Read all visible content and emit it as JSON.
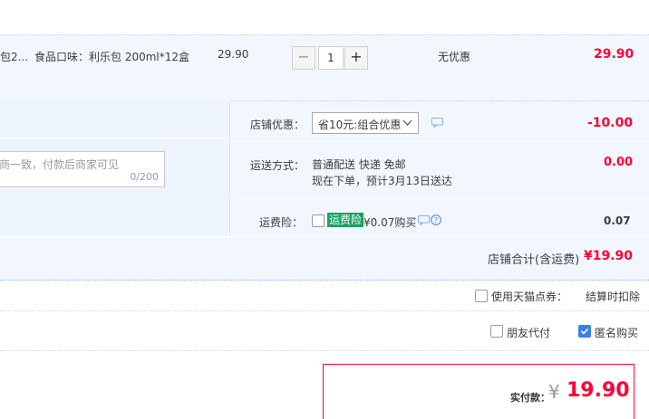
{
  "item": {
    "title_fragment": "包2...",
    "spec": "食品口味：利乐包 200ml*12盒",
    "unit_price": "29.90",
    "qty_minus": "−",
    "qty_value": "1",
    "qty_plus": "+",
    "discount_text": "无优惠",
    "subtotal": "29.90"
  },
  "shop_discount": {
    "label": "店铺优惠：",
    "selected": "省10元:组合优惠",
    "amount": "-10.00"
  },
  "shipping": {
    "label": "运送方式：",
    "line1": "普通配送 快递 免邮",
    "line2": "现在下单，预计3月13日送达",
    "amount": "0.00"
  },
  "insurance": {
    "label": "运费险：",
    "tag": "运费险",
    "price_text": "¥0.07购买",
    "amount": "0.07"
  },
  "message": {
    "placeholder_fragment": "商一致，付款后商家可见",
    "counter": "0/200"
  },
  "shop_total": {
    "label": "店铺合计(含运费)",
    "amount": "¥19.90"
  },
  "points": {
    "label": "使用天猫点券：",
    "note": "结算时扣除"
  },
  "options": {
    "friend_pay": "朋友代付",
    "anonymous": "匿名购买",
    "anonymous_checked": true,
    "friend_pay_checked": false
  },
  "payment": {
    "label": "实付款：",
    "currency": "¥",
    "amount": "19.90"
  },
  "colors": {
    "accent_red": "#ff0036",
    "panel_bg": "#f2f7ff",
    "tag_green": "#1aa260",
    "link_blue": "#3a80e6"
  }
}
